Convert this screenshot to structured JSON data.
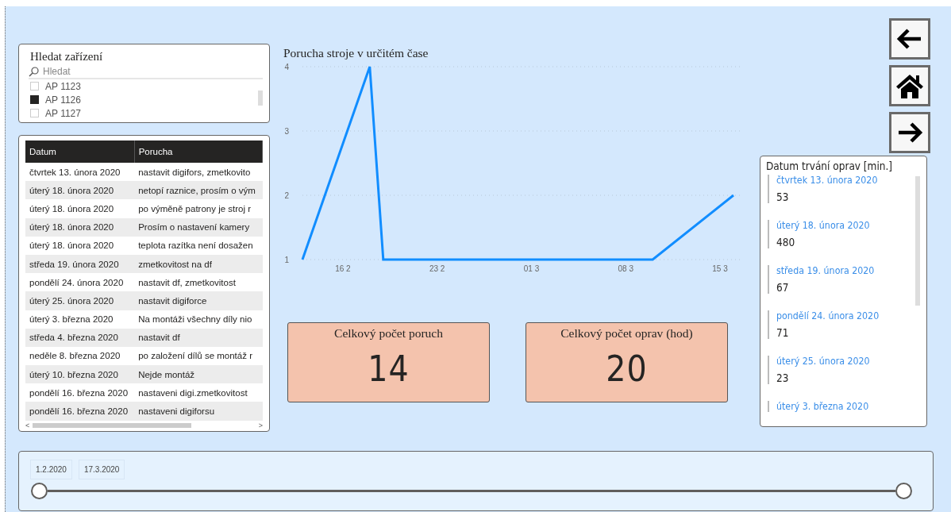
{
  "slicer": {
    "title": "Hledat zařízení",
    "search": {
      "placeholder": "Hledat"
    },
    "items": [
      {
        "label": "AP 1123",
        "checked": false
      },
      {
        "label": "AP 1126",
        "checked": true
      },
      {
        "label": "AP 1127",
        "checked": false
      }
    ]
  },
  "table": {
    "columns": [
      "Datum",
      "Porucha"
    ],
    "rows": [
      [
        "čtvrtek 13. února 2020",
        "nastavit digifors, zmetkovito"
      ],
      [
        "úterý 18. února 2020",
        "netopí raznice, prosím o vým"
      ],
      [
        "úterý 18. února 2020",
        "po výměně patrony je stroj r"
      ],
      [
        "úterý 18. února 2020",
        "Prosím o nastavení kamery"
      ],
      [
        "úterý 18. února 2020",
        "teplota razítka není dosažen"
      ],
      [
        "středa 19. února 2020",
        "zmetkovitost na df"
      ],
      [
        "pondělí 24. února 2020",
        "nastavit df, zmetkovitost"
      ],
      [
        "úterý 25. února 2020",
        "nastavit digiforce"
      ],
      [
        "úterý 3. března 2020",
        "Na montáži všechny díly nio"
      ],
      [
        "středa 4. března 2020",
        "nastavit df"
      ],
      [
        "neděle 8. března 2020",
        "po založení dílů se montáž r"
      ],
      [
        "úterý 10. března 2020",
        "Nejde montáž"
      ],
      [
        "pondělí 16. března 2020",
        "nastaveni digi.zmetkovitost"
      ],
      [
        "pondělí 16. března 2020",
        "nastaveni digiforsu"
      ]
    ],
    "scroll_left": "<",
    "scroll_right": ">"
  },
  "chart": {
    "chart_data": {
      "type": "line",
      "title": "Porucha stroje v určitém čase",
      "categories": [
        null,
        null,
        null,
        "16 2",
        null,
        null,
        null,
        null,
        null,
        null,
        "23 2",
        null,
        null,
        null,
        null,
        null,
        null,
        "01 3",
        null,
        null,
        null,
        null,
        null,
        null,
        "08 3",
        null,
        null,
        null,
        null,
        null,
        null,
        "15 3",
        null
      ],
      "series": [
        {
          "color": "#118dff",
          "values": [
            1,
            null,
            null,
            null,
            null,
            4,
            1,
            null,
            null,
            null,
            null,
            1,
            1,
            null,
            null,
            null,
            null,
            null,
            null,
            1,
            1,
            null,
            null,
            null,
            1,
            null,
            1,
            null,
            null,
            null,
            null,
            null,
            2
          ]
        }
      ],
      "ylim": [
        1,
        4
      ],
      "yticks": [
        1,
        2,
        3,
        4
      ]
    }
  },
  "kpis": [
    {
      "label": "Celkový počet poruch",
      "value": "14"
    },
    {
      "label": "Celkový počet oprav (hod)",
      "value": "20"
    }
  ],
  "nav_buttons": [
    {
      "kind": "back"
    },
    {
      "kind": "home"
    },
    {
      "kind": "forward"
    }
  ],
  "repairs": {
    "title": "Datum trvání oprav [min.]",
    "items": [
      {
        "date": "čtvrtek 13. února 2020",
        "value": "53"
      },
      {
        "date": "úterý 18. února 2020",
        "value": "480"
      },
      {
        "date": "středa 19. února 2020",
        "value": "67"
      },
      {
        "date": "pondělí 24. února 2020",
        "value": "71"
      },
      {
        "date": "úterý 25. února 2020",
        "value": "23"
      },
      {
        "date": "úterý 3. března 2020"
      }
    ]
  },
  "date_range": {
    "from": "1.2.2020",
    "to": "17.3.2020",
    "handles": [
      {
        "level": 0
      },
      {
        "level": 1
      }
    ]
  }
}
